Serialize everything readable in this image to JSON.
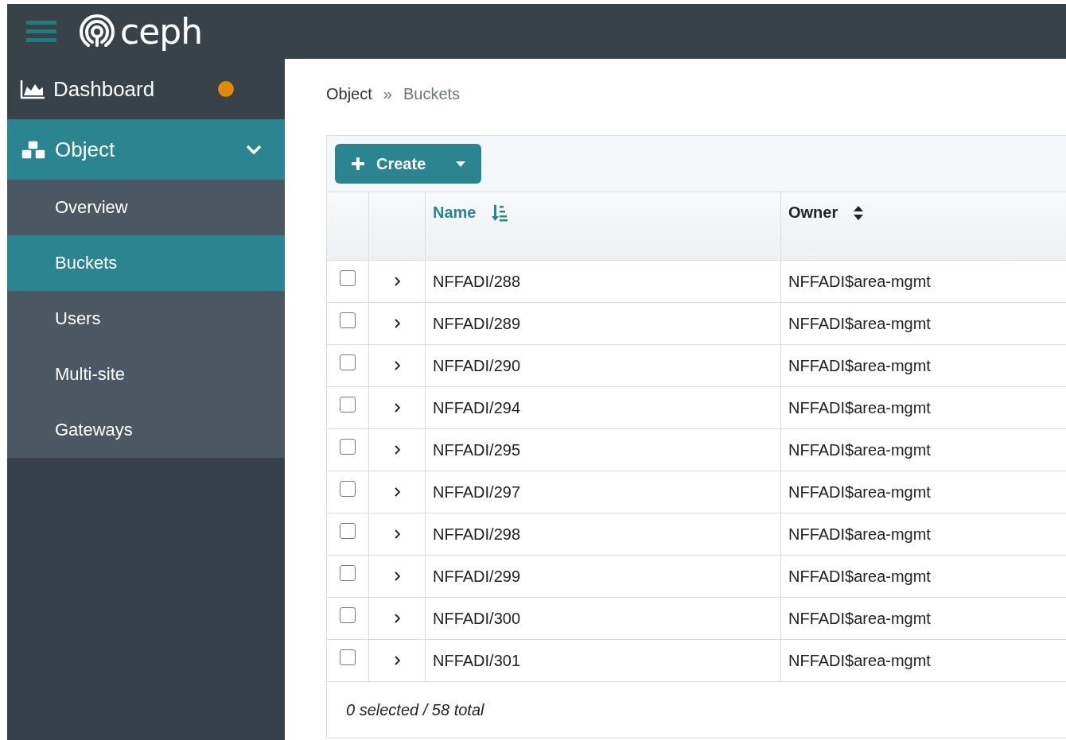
{
  "brand": {
    "name": "ceph"
  },
  "sidebar": {
    "items": [
      {
        "label": "Dashboard",
        "selected": false,
        "alert": true
      },
      {
        "label": "Object",
        "selected": true,
        "expanded": true,
        "children": [
          {
            "label": "Overview",
            "selected": false
          },
          {
            "label": "Buckets",
            "selected": true
          },
          {
            "label": "Users",
            "selected": false
          },
          {
            "label": "Multi-site",
            "selected": false
          },
          {
            "label": "Gateways",
            "selected": false
          }
        ]
      }
    ]
  },
  "breadcrumb": {
    "items": [
      "Object",
      "Buckets"
    ],
    "separator": "»"
  },
  "toolbar": {
    "create_label": "Create"
  },
  "table": {
    "columns": [
      {
        "label": "Name",
        "sorted": true
      },
      {
        "label": "Owner",
        "sorted": false
      }
    ],
    "rows": [
      {
        "checked": false,
        "expanded": false,
        "cells": [
          "NFFADI/288",
          "NFFADI$area-mgmt"
        ]
      },
      {
        "checked": false,
        "expanded": false,
        "cells": [
          "NFFADI/289",
          "NFFADI$area-mgmt"
        ]
      },
      {
        "checked": false,
        "expanded": false,
        "cells": [
          "NFFADI/290",
          "NFFADI$area-mgmt"
        ]
      },
      {
        "checked": false,
        "expanded": false,
        "cells": [
          "NFFADI/294",
          "NFFADI$area-mgmt"
        ]
      },
      {
        "checked": false,
        "expanded": false,
        "cells": [
          "NFFADI/295",
          "NFFADI$area-mgmt"
        ]
      },
      {
        "checked": false,
        "expanded": false,
        "cells": [
          "NFFADI/297",
          "NFFADI$area-mgmt"
        ]
      },
      {
        "checked": false,
        "expanded": false,
        "cells": [
          "NFFADI/298",
          "NFFADI$area-mgmt"
        ]
      },
      {
        "checked": false,
        "expanded": false,
        "cells": [
          "NFFADI/299",
          "NFFADI$area-mgmt"
        ]
      },
      {
        "checked": false,
        "expanded": false,
        "cells": [
          "NFFADI/300",
          "NFFADI$area-mgmt"
        ]
      },
      {
        "checked": false,
        "expanded": false,
        "cells": [
          "NFFADI/301",
          "NFFADI$area-mgmt"
        ]
      }
    ],
    "footer": "0 selected / 58 total"
  }
}
